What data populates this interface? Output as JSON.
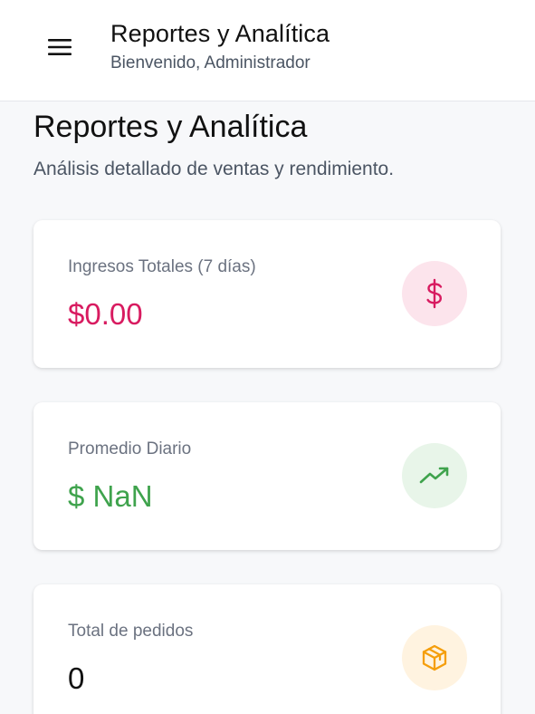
{
  "header": {
    "title": "Reportes y Analítica",
    "subtitle": "Bienvenido, Administrador",
    "menu_icon": "hamburger-menu-icon"
  },
  "page": {
    "title": "Reportes y Analítica",
    "description": "Análisis detallado de ventas y rendimiento."
  },
  "stats": [
    {
      "label": "Ingresos Totales (7 días)",
      "value": "$0.00",
      "icon": "dollar-icon",
      "value_color": "#d81b60",
      "icon_color": "#d81b60",
      "icon_bg": "#fce4ec"
    },
    {
      "label": "Promedio Diario",
      "value": "$ NaN",
      "icon": "trending-up-icon",
      "value_color": "#3fa34d",
      "icon_color": "#3fa34d",
      "icon_bg": "#e8f5e9"
    },
    {
      "label": "Total de pedidos",
      "value": "0",
      "icon": "package-icon",
      "value_color": "#111111",
      "icon_color": "#f59e0b",
      "icon_bg": "#fff3e0"
    }
  ]
}
